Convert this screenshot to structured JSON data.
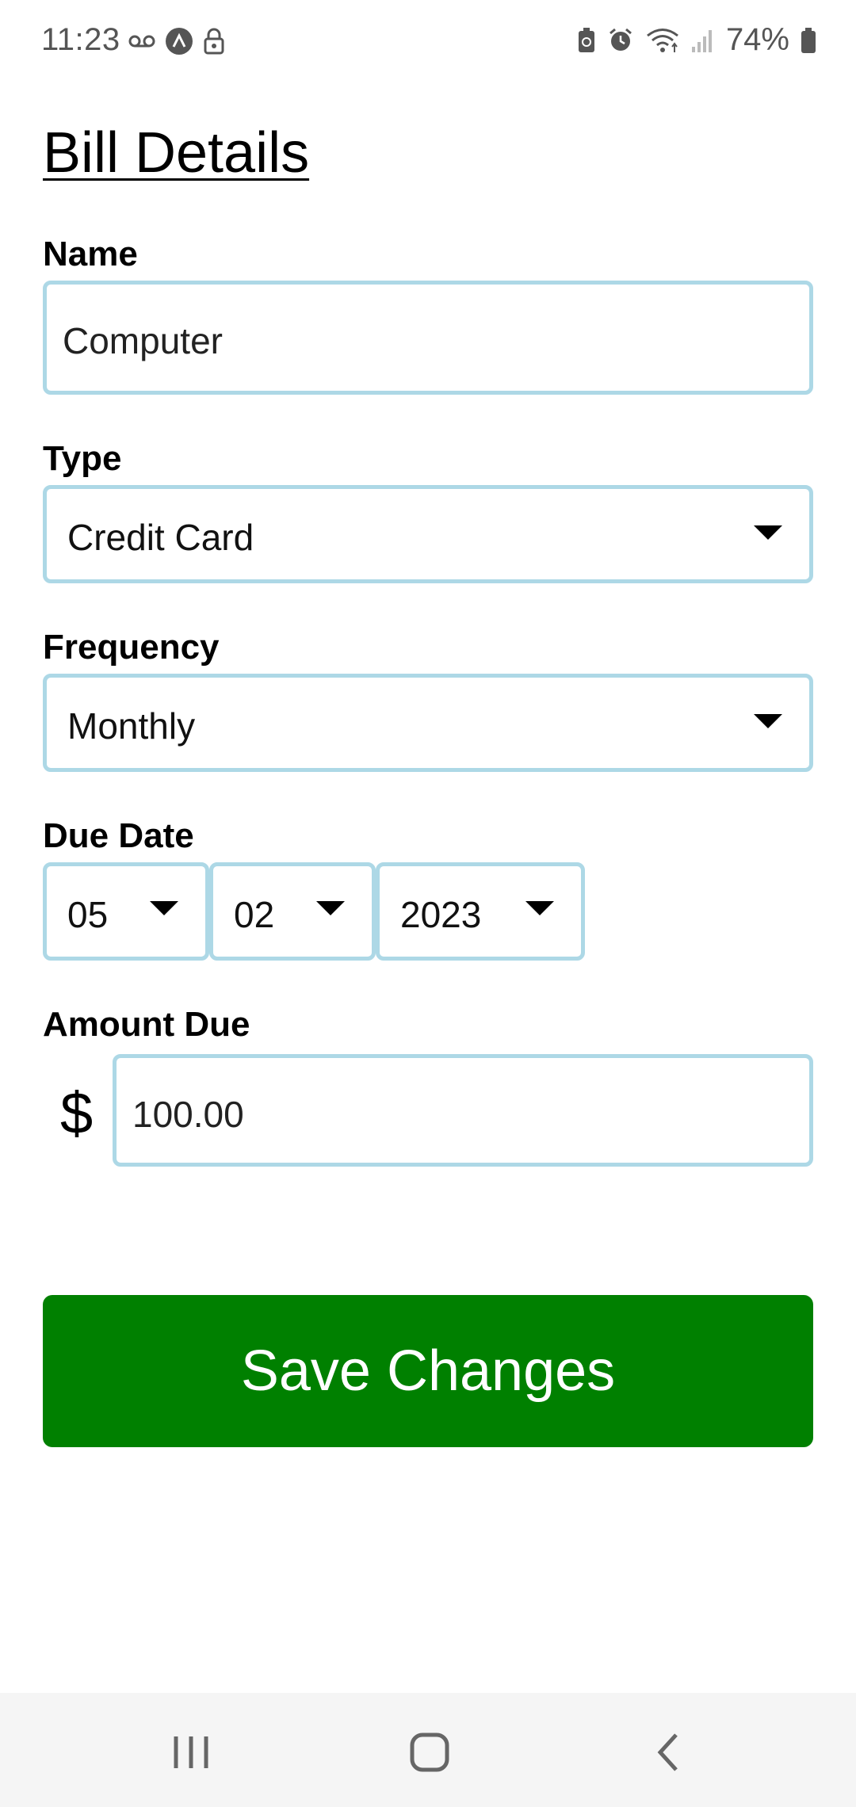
{
  "status_bar": {
    "time": "11:23",
    "battery_percent": "74%",
    "left_icons": [
      "voicemail-icon",
      "app-notification-icon",
      "lock-icon"
    ],
    "right_icons": [
      "battery-saver-icon",
      "alarm-icon",
      "wifi-icon",
      "signal-icon",
      "battery-icon"
    ]
  },
  "page": {
    "title": "Bill Details"
  },
  "form": {
    "name_label": "Name",
    "name_value": "Computer",
    "type_label": "Type",
    "type_value": "Credit Card",
    "frequency_label": "Frequency",
    "frequency_value": "Monthly",
    "due_date_label": "Due Date",
    "due_month": "05",
    "due_day": "02",
    "due_year": "2023",
    "amount_label": "Amount Due",
    "currency_symbol": "$",
    "amount_value": "100.00"
  },
  "actions": {
    "save_label": "Save Changes"
  },
  "colors": {
    "field_border": "#add8e6",
    "save_button": "#008000",
    "navbar_bg": "#f5f5f5"
  },
  "nav_bar": {
    "icons": [
      "recent-apps-icon",
      "home-icon",
      "back-icon"
    ]
  }
}
